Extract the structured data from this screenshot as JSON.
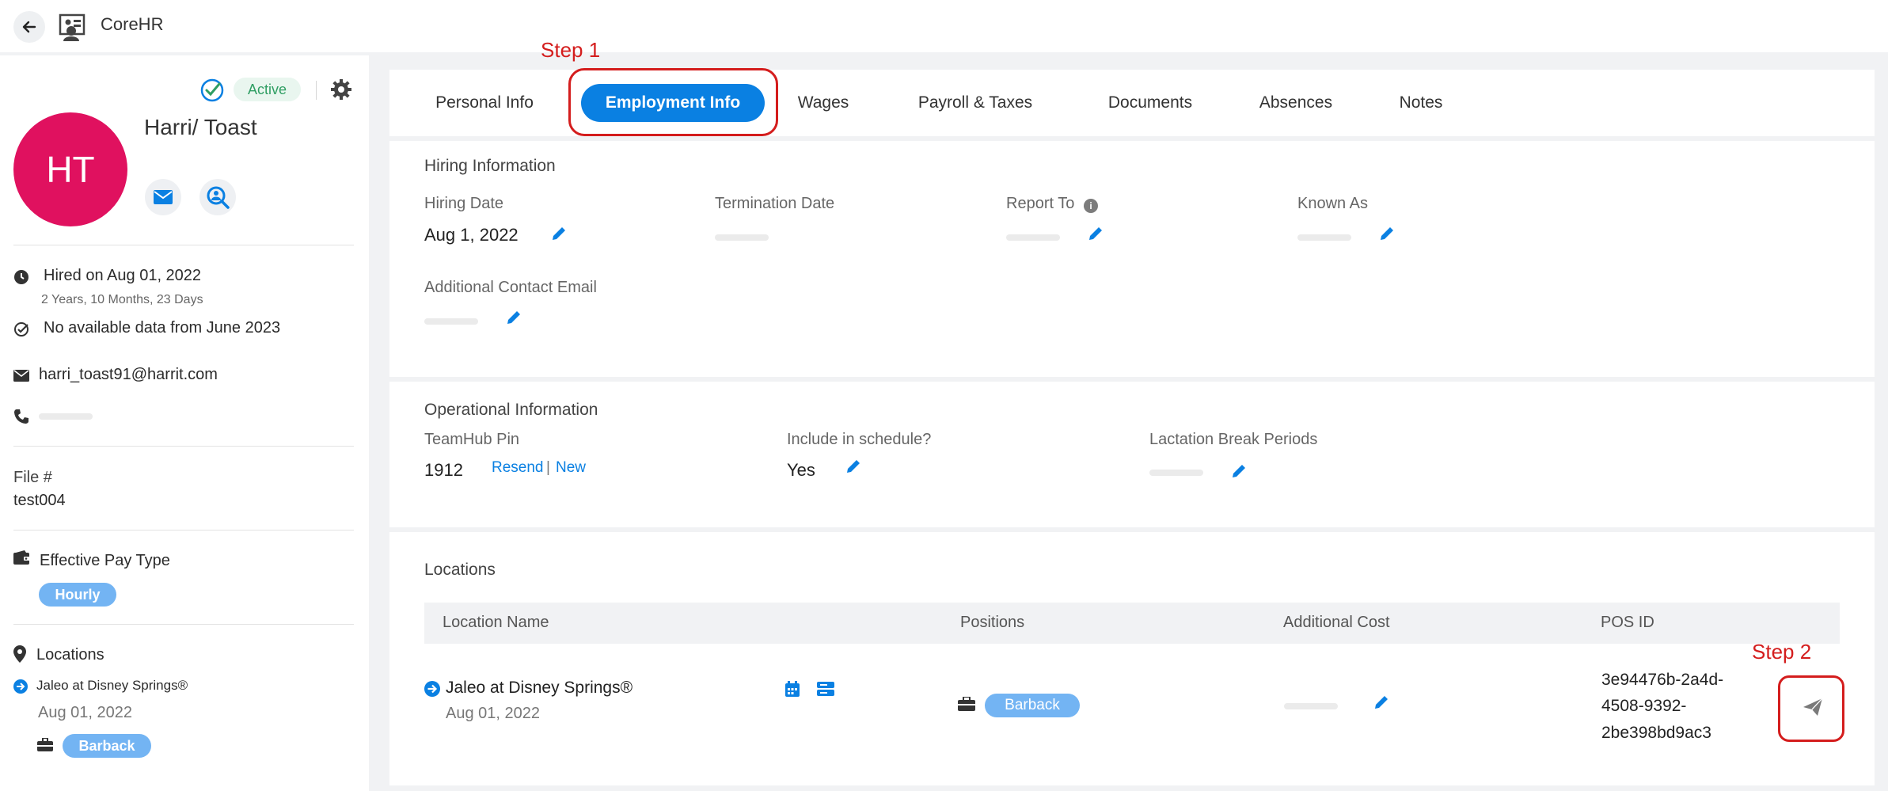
{
  "app": {
    "title": "CoreHR"
  },
  "icons": {
    "back": "arrow-left-icon",
    "app_logo": "people-org-icon",
    "status": "check-circle-icon",
    "settings": "gear-icon",
    "email": "envelope-icon",
    "search_person": "search-person-icon",
    "clock": "clock-icon",
    "check": "check-circle-outline-icon",
    "phone": "phone-icon",
    "wallet": "wallet-icon",
    "map_marker": "map-marker-icon",
    "arrow_circle": "arrow-right-circle-icon",
    "briefcase": "briefcase-icon",
    "pencil": "pencil-icon",
    "info": "info-icon",
    "calendar": "calendar-icon",
    "server": "server-icon",
    "send": "paper-plane-icon"
  },
  "colors": {
    "accent": "#0a80e2",
    "avatar": "#e0115f",
    "status_green": "#2f9e63",
    "annotation_red": "#d41d1d",
    "pill_blue": "#73b4f3"
  },
  "sidebar": {
    "status": "Active",
    "avatar_initials": "HT",
    "name": "Harri/ Toast",
    "hired": "Hired on Aug 01, 2022",
    "tenure": "2 Years, 10 Months, 23 Days",
    "no_data": "No available data from June 2023",
    "email": "harri_toast91@harrit.com",
    "file_label": "File #",
    "file_value": "test004",
    "pay_type_label": "Effective Pay Type",
    "pay_type_value": "Hourly",
    "locations_label": "Locations",
    "location_name": "Jaleo at Disney Springs®",
    "location_date": "Aug 01, 2022",
    "position": "Barback"
  },
  "tabs": [
    {
      "label": "Personal Info"
    },
    {
      "label": "Employment Info",
      "active": true
    },
    {
      "label": "Wages"
    },
    {
      "label": "Payroll & Taxes"
    },
    {
      "label": "Documents"
    },
    {
      "label": "Absences"
    },
    {
      "label": "Notes"
    }
  ],
  "annotations": {
    "step1": "Step 1",
    "step2": "Step 2"
  },
  "hiring": {
    "title": "Hiring Information",
    "hiring_date_label": "Hiring Date",
    "hiring_date_value": "Aug 1, 2022",
    "termination_label": "Termination Date",
    "report_to_label": "Report To",
    "known_as_label": "Known As",
    "additional_email_label": "Additional Contact Email"
  },
  "operational": {
    "title": "Operational Information",
    "pin_label": "TeamHub Pin",
    "pin_value": "1912",
    "resend": "Resend",
    "separator": "|",
    "new": "New",
    "schedule_label": "Include in schedule?",
    "schedule_value": "Yes",
    "lactation_label": "Lactation Break Periods"
  },
  "locations": {
    "title": "Locations",
    "columns": [
      "Location Name",
      "Positions",
      "Additional Cost",
      "POS ID"
    ],
    "row": {
      "name": "Jaleo at Disney Springs®",
      "date": "Aug 01, 2022",
      "position": "Barback",
      "pos_id_lines": [
        "3e94476b-2a4d-",
        "4508-9392-",
        "2be398bd9ac3"
      ]
    }
  }
}
